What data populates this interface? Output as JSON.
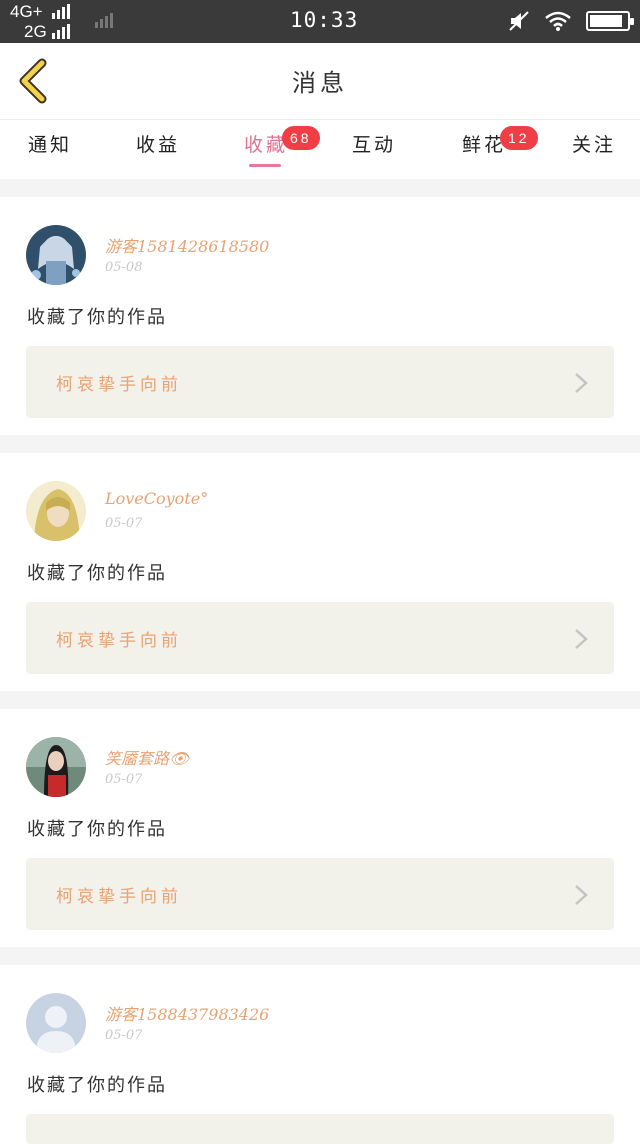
{
  "status": {
    "network1": "4G+",
    "network2": "2G",
    "time": "10:33",
    "battery_level": 0.9
  },
  "header": {
    "title": "消息",
    "accent": "#f2d34a"
  },
  "tabs": [
    {
      "label": "通知"
    },
    {
      "label": "收益"
    },
    {
      "label": "收藏",
      "badge": "68",
      "active": true
    },
    {
      "label": "互动"
    },
    {
      "label": "鲜花",
      "badge": "12"
    },
    {
      "label": "关注"
    }
  ],
  "feed": [
    {
      "username": "游客15814286185​80",
      "date": "05-08",
      "action": "收藏了你的作品",
      "work_title": "柯哀挚手向前",
      "avatar": "anime-girl-blue"
    },
    {
      "username": "LoveCoyote°",
      "date": "05-07",
      "action": "收藏了你的作品",
      "work_title": "柯哀挚手向前",
      "avatar": "anime-blonde"
    },
    {
      "username": "笑靥套路👁",
      "date": "05-07",
      "action": "收藏了你的作品",
      "work_title": "柯哀挚手向前",
      "avatar": "photo-girl-red"
    },
    {
      "username": "游客15884379834​26",
      "date": "05-07",
      "action": "收藏了你的作品",
      "work_title": "",
      "avatar": "default-avatar"
    }
  ]
}
